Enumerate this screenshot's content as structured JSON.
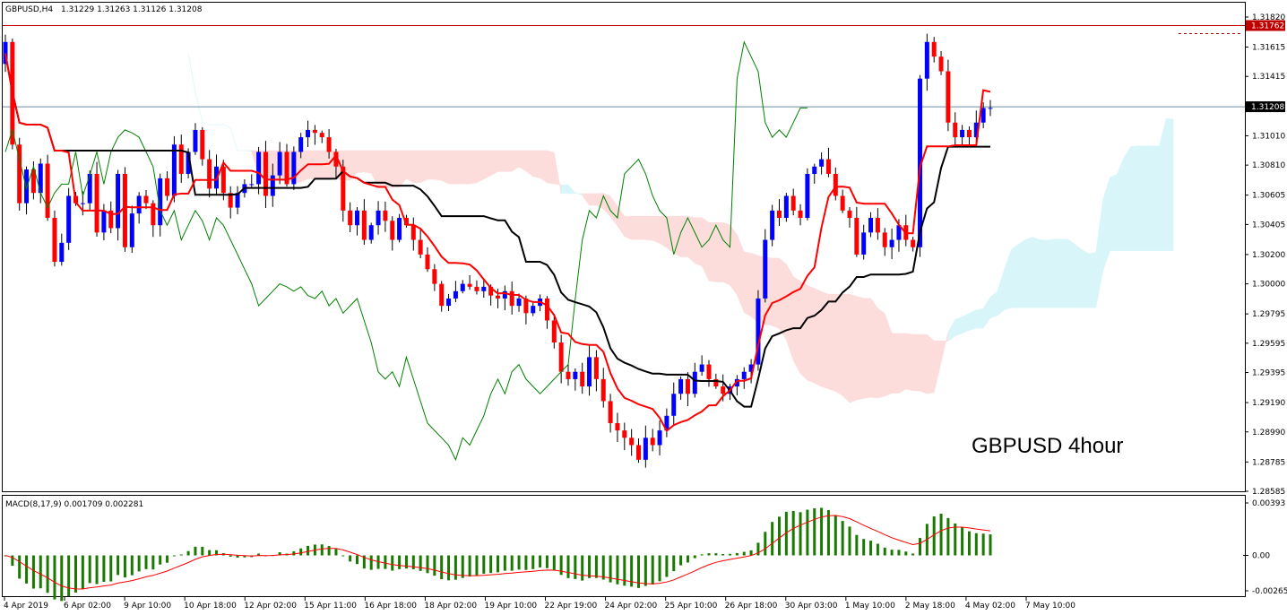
{
  "header": {
    "symbol": "GBPUSD,H4",
    "ohlc": "1.31229 1.31263 1.31126 1.31208"
  },
  "annotation": "GBPUSD 4hour",
  "macd": {
    "label": "MACD(8,17,9) 0.001709 0.002281",
    "ticks": [
      "0.00393",
      "0.00",
      "-0.002653"
    ]
  },
  "colors": {
    "bull": "#0000ff",
    "bear": "#ff0000",
    "tenkan": "#ff0000",
    "kijun": "#000000",
    "chikou": "#008000",
    "cloud_bear": "#fddcdc",
    "cloud_bull": "#d8f6fa",
    "hist": "#1a7a00",
    "signal": "#ff0000",
    "resistance": "#c00000",
    "price_line": "#6e8ca0"
  },
  "chart_data": {
    "type": "candlestick",
    "symbol": "GBPUSD",
    "timeframe": "H4",
    "ylim": [
      1.28585,
      1.3182
    ],
    "y_ticks": [
      "1.31820",
      "1.31615",
      "1.31415",
      "1.31208",
      "1.31010",
      "1.30810",
      "1.30605",
      "1.30405",
      "1.30200",
      "1.30000",
      "1.29795",
      "1.29595",
      "1.29395",
      "1.29190",
      "1.28990",
      "1.28785",
      "1.28585"
    ],
    "current_price": "1.31208",
    "resistance": "1.31762",
    "x_labels": [
      "4 Apr 2019",
      "6 Apr 02:00",
      "9 Apr 10:00",
      "10 Apr 18:00",
      "12 Apr 02:00",
      "15 Apr 11:00",
      "16 Apr 18:00",
      "18 Apr 02:00",
      "19 Apr 10:00",
      "22 Apr 19:00",
      "24 Apr 02:00",
      "25 Apr 10:00",
      "26 Apr 18:00",
      "30 Apr 03:00",
      "1 May 10:00",
      "2 May 18:00",
      "4 May 02:00",
      "7 May 10:00"
    ],
    "close": [
      1.3165,
      1.3095,
      1.3055,
      1.3078,
      1.3062,
      1.3082,
      1.3045,
      1.3015,
      1.3028,
      1.306,
      1.3055,
      1.3055,
      1.3075,
      1.3035,
      1.305,
      1.3038,
      1.3075,
      1.3025,
      1.3048,
      1.306,
      1.3055,
      1.304,
      1.3072,
      1.306,
      1.3095,
      1.3075,
      1.309,
      1.3105,
      1.3085,
      1.3065,
      1.308,
      1.3062,
      1.3052,
      1.3062,
      1.3068,
      1.3068,
      1.309,
      1.306,
      1.3074,
      1.309,
      1.3068,
      1.309,
      1.31,
      1.3105,
      1.3103,
      1.31,
      1.309,
      1.308,
      1.305,
      1.304,
      1.305,
      1.303,
      1.304,
      1.305,
      1.3043,
      1.303,
      1.3045,
      1.304,
      1.303,
      1.302,
      1.301,
      1.3,
      1.2985,
      1.299,
      1.2995,
      1.3,
      1.2998,
      1.2995,
      1.2998,
      1.2992,
      1.299,
      1.2995,
      1.2985,
      1.299,
      1.298,
      1.2985,
      1.299,
      1.2975,
      1.296,
      1.294,
      1.2935,
      1.294,
      1.293,
      1.295,
      1.2935,
      1.292,
      1.2905,
      1.29,
      1.2895,
      1.289,
      1.288,
      1.2895,
      1.289,
      1.29,
      1.291,
      1.2925,
      1.2935,
      1.2925,
      1.294,
      1.2945,
      1.2935,
      1.293,
      1.2925,
      1.293,
      1.2935,
      1.294,
      1.2945,
      1.299,
      1.303,
      1.305,
      1.3045,
      1.306,
      1.305,
      1.3045,
      1.3075,
      1.308,
      1.3085,
      1.3075,
      1.306,
      1.305,
      1.3045,
      1.302,
      1.3035,
      1.3045,
      1.3035,
      1.3025,
      1.303,
      1.304,
      1.303,
      1.3025,
      1.314,
      1.3165,
      1.3155,
      1.3145,
      1.311,
      1.31,
      1.3105,
      1.31,
      1.311,
      1.312,
      1.312
    ]
  }
}
